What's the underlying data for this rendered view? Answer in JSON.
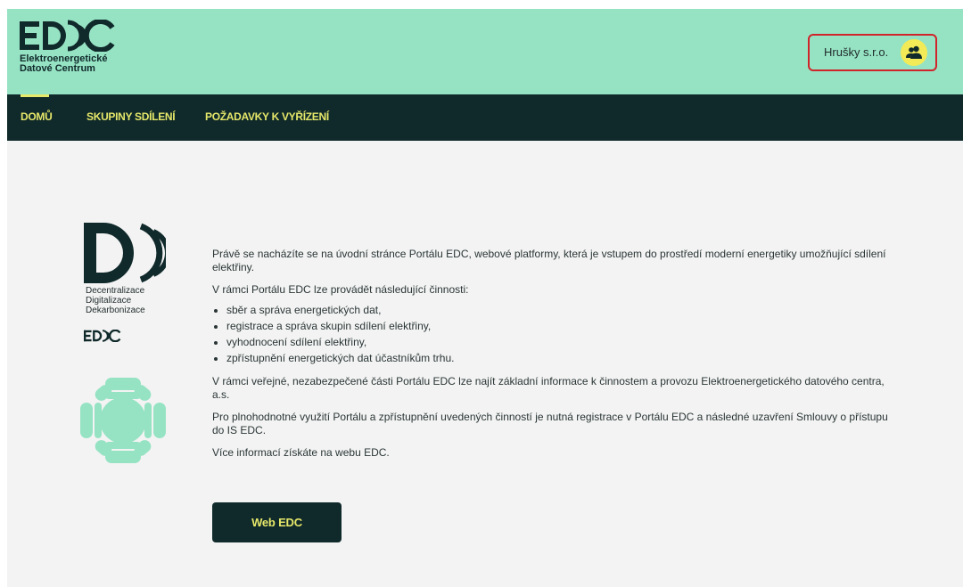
{
  "app": {
    "logo_text": "EDC",
    "logo_lines": [
      "Elektroenergetické",
      "Datové Centrum"
    ]
  },
  "user": {
    "name": "Hrušky s.r.o.",
    "avatar_icon": "users-icon"
  },
  "nav": {
    "items": [
      {
        "label": "DOMŮ",
        "active": true
      },
      {
        "label": "SKUPINY SDÍLENÍ",
        "active": false
      },
      {
        "label": "POŽADAVKY K VYŘÍZENÍ",
        "active": false
      }
    ]
  },
  "branding": {
    "ddd_words": [
      "Decentralizace",
      "Digitalizace",
      "Dekarbonizace"
    ],
    "small_logo_text": "EDC"
  },
  "content": {
    "intro": "Právě se nacházíte se na úvodní stránce Portálu EDC, webové platformy, která je vstupem do prostředí moderní energetiky umožňující sdílení elektřiny.",
    "activities_heading": "V rámci Portálu EDC lze provádět následující činnosti:",
    "activities": [
      "sběr a správa energetických dat,",
      "registrace a správa skupin sdílení elektřiny,",
      "vyhodnocení sdílení elektřiny,",
      "zpřístupnění energetických dat účastníkům trhu."
    ],
    "public_info": "V rámci veřejné, nezabezpečené části Portálu EDC lze najít základní informace k činnostem a provozu Elektroenergetického datového centra, a.s.",
    "registration": "Pro plnohodnotné využití Portálu a zpřístupnění uvedených činností je nutná registrace v Portálu EDC a následné uzavření Smlouvy o přístupu do IS EDC.",
    "more_info": "Více informací získáte na webu EDC.",
    "button_label": "Web EDC"
  },
  "colors": {
    "header_bg": "#96e3c4",
    "nav_bg": "#10292a",
    "accent": "#e6e86a",
    "highlight": "#d1232a",
    "avatar_bg": "#f2ea56"
  }
}
